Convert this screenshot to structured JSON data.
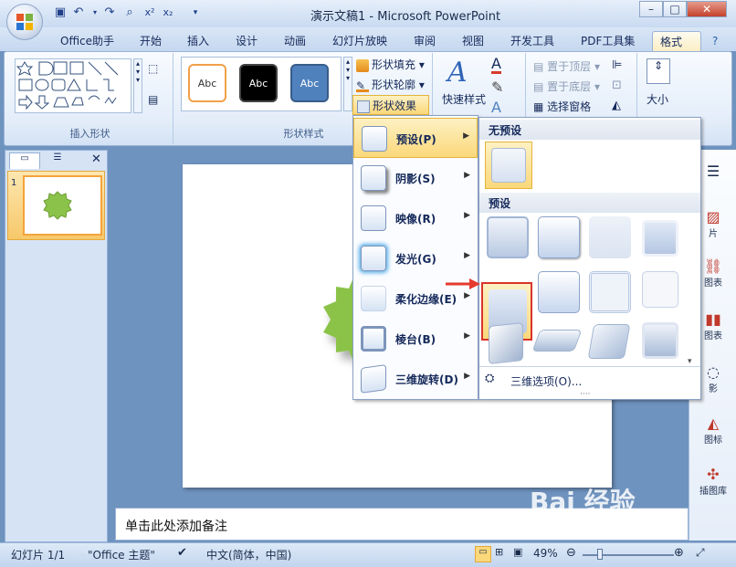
{
  "window": {
    "title": "演示文稿1 - Microsoft PowerPoint"
  },
  "tabs": [
    "Office助手",
    "开始",
    "插入",
    "设计",
    "动画",
    "幻灯片放映",
    "审阅",
    "视图",
    "开发工具",
    "PDF工具集",
    "格式"
  ],
  "ribbon": {
    "insert_shapes_label": "插入形状",
    "shape_styles_label": "形状样式",
    "style_swatches": [
      "Abc",
      "Abc",
      "Abc"
    ],
    "shape_fill": "形状填充",
    "shape_outline": "形状轮廓",
    "shape_effects": "形状效果",
    "quick_styles": "快速样式",
    "bring_to_front": "置于顶层",
    "send_to_back": "置于底层",
    "selection_pane": "选择窗格",
    "size": "大小"
  },
  "effects_menu": {
    "items": [
      {
        "label": "预设(P)"
      },
      {
        "label": "阴影(S)"
      },
      {
        "label": "映像(R)"
      },
      {
        "label": "发光(G)"
      },
      {
        "label": "柔化边缘(E)"
      },
      {
        "label": "棱台(B)"
      },
      {
        "label": "三维旋转(D)"
      }
    ]
  },
  "preset_panel": {
    "no_preset_header": "无预设",
    "preset_header": "预设",
    "three_d_options": "三维选项(O)..."
  },
  "slides_panel": {
    "slide_number": "1"
  },
  "notes": {
    "placeholder": "单击此处添加备注"
  },
  "right_strip": {
    "items": [
      "片",
      "图表",
      "图表",
      "影",
      "图标",
      "插图库"
    ]
  },
  "status": {
    "slide": "幻灯片 1/1",
    "theme": "\"Office 主题\"",
    "language": "中文(简体，中国)",
    "zoom": "49%"
  },
  "watermark": {
    "text": "Bai 经验"
  },
  "colors": {
    "accent_orange": "#f4a33b",
    "shape_green": "#8bc34a",
    "highlight_red": "#d9342b"
  }
}
